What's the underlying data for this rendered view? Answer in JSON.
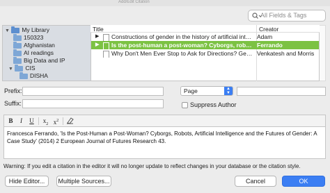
{
  "window": {
    "title": "Add/Edit Citation"
  },
  "search": {
    "placeholder": "All Fields & Tags"
  },
  "library": {
    "items": [
      {
        "label": "My Library",
        "arrow": "▼",
        "depth": 0,
        "kind": "library"
      },
      {
        "label": "150323",
        "arrow": "",
        "depth": 1,
        "kind": "folder"
      },
      {
        "label": "Afghanistan",
        "arrow": "",
        "depth": 1,
        "kind": "folder"
      },
      {
        "label": "AI readings",
        "arrow": "",
        "depth": 1,
        "kind": "folder"
      },
      {
        "label": "Big Data and IP",
        "arrow": "",
        "depth": 1,
        "kind": "folder"
      },
      {
        "label": "CIS",
        "arrow": "▼",
        "depth": 1,
        "kind": "folder"
      },
      {
        "label": "DISHA",
        "arrow": "",
        "depth": 2,
        "kind": "folder"
      }
    ]
  },
  "items": {
    "headers": {
      "title": "Title",
      "creator": "Creator"
    },
    "rows": [
      {
        "arrow": "▶",
        "title": "Constructions of gender in the history of artificial intelligence",
        "creator": "Adam"
      },
      {
        "arrow": "▶",
        "title": "Is the post-human a post-woman? Cyborgs, robots, artificial intelligence and the futures of gender",
        "creator": "Ferrando"
      },
      {
        "arrow": "",
        "title": "Why Don't Men Ever Stop to Ask for Directions? Gender, Social Influence",
        "creator": "Venkatesh and Morris"
      }
    ]
  },
  "form": {
    "prefix_label": "Prefix:",
    "suffix_label": "Suffix:",
    "prefix_value": "",
    "suffix_value": "",
    "locator_value": "Page",
    "locator_number": "",
    "suppress_author_label": "Suppress Author"
  },
  "editor": {
    "text": "Francesca Ferrando, 'Is the Post-Human a Post-Woman? Cyborgs, Robots, Artificial Intelligence and the Futures of Gender: A Case Study' (2014) 2 European Journal of Futures Research 43."
  },
  "warning": "Warning: If you edit a citation in the editor it will no longer update to reflect changes in your database or the citation style.",
  "buttons": {
    "hide_editor": "Hide Editor...",
    "multiple_sources": "Multiple Sources...",
    "cancel": "Cancel",
    "ok": "OK"
  },
  "colors": {
    "selection": "#7cc243",
    "accent": "#3b7ef3"
  }
}
